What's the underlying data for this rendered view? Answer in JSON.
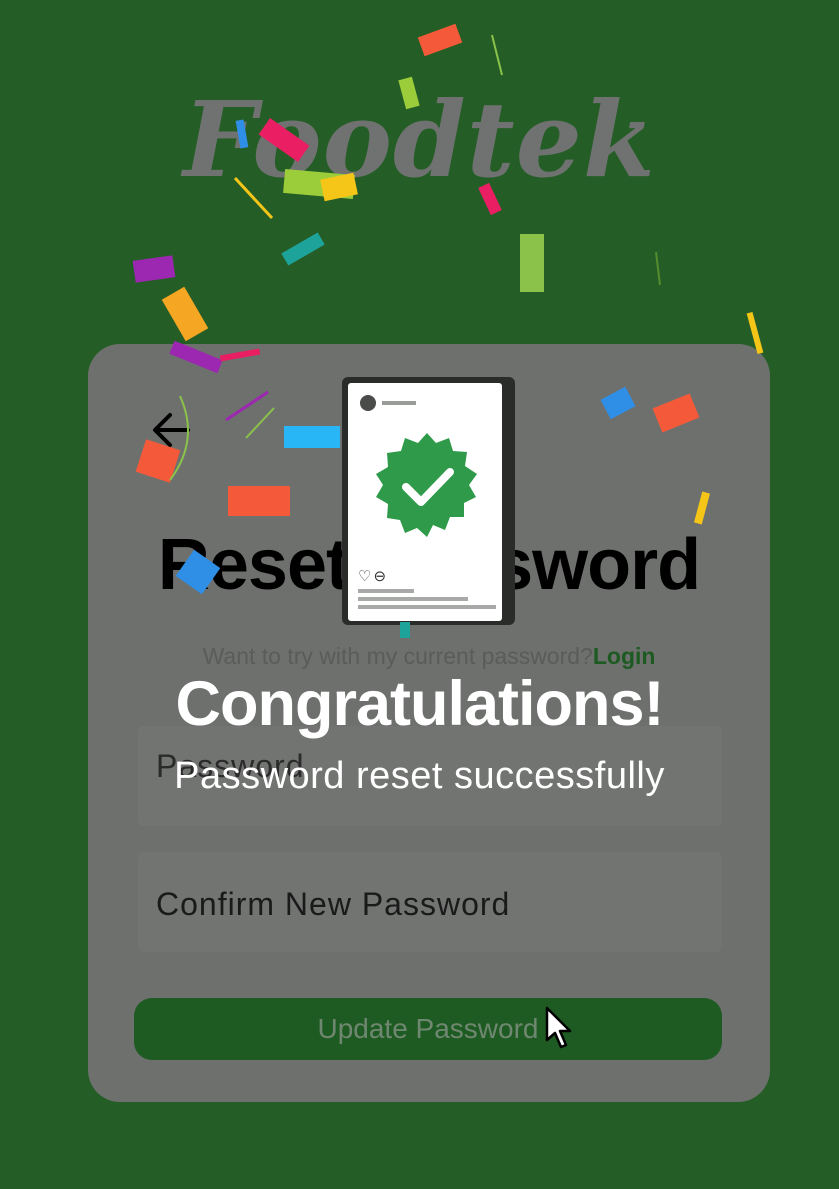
{
  "app": {
    "logo_text": "Foodtek"
  },
  "form": {
    "title": "Reset Password",
    "subtitle": "Want to try with my current password?",
    "login_link": "Login",
    "password_label": "Password",
    "confirm_label": "Confirm New Password",
    "submit_label": "Update Password"
  },
  "dialog": {
    "title": "Congratulations!",
    "message": "Password reset successfully",
    "badge_icon": "verified-check-icon"
  },
  "colors": {
    "background": "#2a6a2c",
    "card": "#6e706e",
    "button": "#1e5b22",
    "badge": "#2f9b4a",
    "link": "#1d5a22"
  }
}
